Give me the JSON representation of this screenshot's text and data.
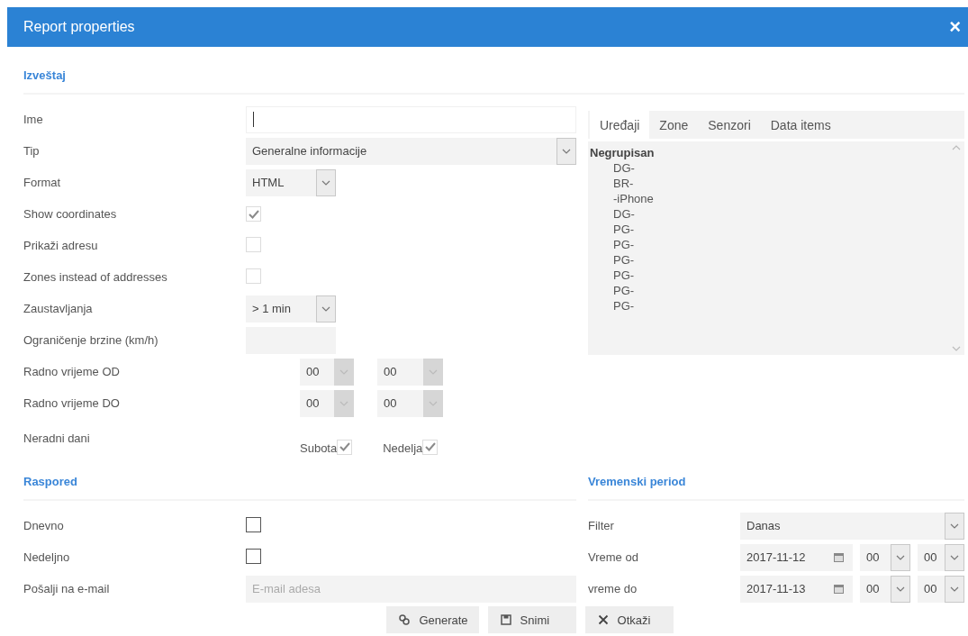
{
  "dialog": {
    "title": "Report properties",
    "close": "×"
  },
  "report": {
    "heading": "Izveštaj",
    "fields": [
      {
        "kind": "text",
        "label": "Ime",
        "focused": true
      },
      {
        "kind": "select",
        "label": "Tip",
        "value": "Generalne informacije"
      },
      {
        "kind": "short_select",
        "label": "Format",
        "value": "HTML"
      },
      {
        "kind": "checkbox",
        "label": "Show coordinates",
        "checked": true,
        "disabled": true
      },
      {
        "kind": "checkbox",
        "label": "Prikaži adresu",
        "checked": false,
        "disabled": true
      },
      {
        "kind": "checkbox",
        "label": "Zones instead of addresses",
        "checked": false,
        "disabled": true
      },
      {
        "kind": "short_select",
        "label": "Zaustavljanja",
        "value": "> 1 min"
      },
      {
        "kind": "short_text",
        "label": "Ograničenje brzine (km/h)",
        "disabled": true
      },
      {
        "kind": "time",
        "label": "Radno vrijeme OD",
        "hour": "00",
        "minute": "00",
        "disabled": true
      },
      {
        "kind": "time",
        "label": "Radno vrijeme DO",
        "hour": "00",
        "minute": "00",
        "disabled": true
      },
      {
        "kind": "days",
        "label": "Neradni dani",
        "days": [
          {
            "label": "Subota",
            "checked": true,
            "disabled": true
          },
          {
            "label": "Nedelja",
            "checked": true,
            "disabled": true
          }
        ]
      }
    ]
  },
  "objects": {
    "tabs": [
      {
        "label": "Uređaji",
        "selected": true
      },
      {
        "label": "Zone",
        "selected": false
      },
      {
        "label": "Senzori",
        "selected": false
      },
      {
        "label": "Data items",
        "selected": false
      }
    ],
    "tree": [
      {
        "label": "Negrupisan",
        "children": [
          {
            "label": "DG-"
          },
          {
            "label": "BR-"
          },
          {
            "label": "-iPhone"
          },
          {
            "label": "DG-"
          },
          {
            "label": "PG-"
          },
          {
            "label": "PG-"
          },
          {
            "label": "PG-"
          },
          {
            "label": "PG-"
          },
          {
            "label": "PG-"
          },
          {
            "label": "PG-"
          }
        ]
      }
    ]
  },
  "schedule": {
    "heading": "Raspored",
    "fields": [
      {
        "kind": "checkbox",
        "label": "Dnevno",
        "checked": false,
        "disabled": false
      },
      {
        "kind": "checkbox",
        "label": "Nedeljno",
        "checked": false,
        "disabled": false
      },
      {
        "kind": "email",
        "label": "Pošalji na e-mail",
        "placeholder": "E-mail adesa"
      }
    ]
  },
  "period": {
    "heading": "Vremenski period",
    "filter": {
      "label": "Filter",
      "value": "Danas"
    },
    "ranges": [
      {
        "label": "Vreme od",
        "date": "2017-11-12",
        "hour": "00",
        "minute": "00"
      },
      {
        "label": "vreme do",
        "date": "2017-11-13",
        "hour": "00",
        "minute": "00"
      }
    ]
  },
  "buttons": [
    {
      "kind": "generate",
      "label": "Generate"
    },
    {
      "kind": "save",
      "label": "Snimi"
    },
    {
      "kind": "cancel",
      "label": "Otkaži"
    }
  ]
}
